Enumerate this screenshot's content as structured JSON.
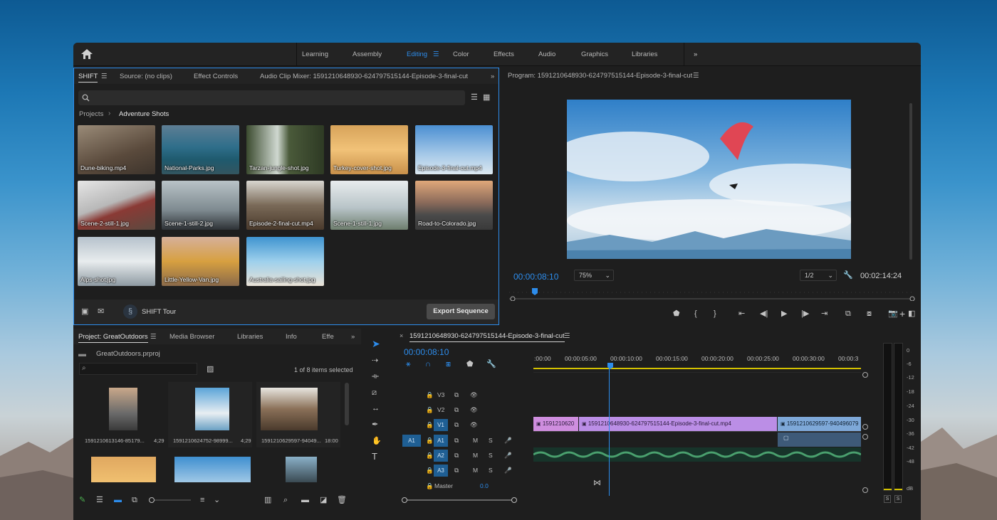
{
  "workspaces": [
    "Learning",
    "Assembly",
    "Editing",
    "Color",
    "Effects",
    "Audio",
    "Graphics",
    "Libraries"
  ],
  "active_workspace": "Editing",
  "source_tabs": {
    "shift": "SHIFT",
    "source": "Source: (no clips)",
    "effect_controls": "Effect Controls",
    "audio_mixer": "Audio Clip Mixer: 1591210648930-624797515144-Episode-3-final-cut"
  },
  "breadcrumb": {
    "root": "Projects",
    "current": "Adventure Shots"
  },
  "assets": [
    "Dune-biking.mp4",
    "National-Parks.jpg",
    "Tarzan-jungle-shot.jpg",
    "Turkey-cover-shot.jpg",
    "Episode-3-final-cut.mp4",
    "Scene-2-still-1.jpg",
    "Scene-1-still-2.jpg",
    "Episode-2-final-cut.mp4",
    "Scene-1-still-1.jpg",
    "Road-to-Colorado.jpg",
    "Alps-shot.jpg",
    "Little-Yellow-Van.jpg",
    "Australia-sailing-shot.jpg"
  ],
  "shift_tour": "SHIFT Tour",
  "export_button": "Export Sequence",
  "program": {
    "title": "Program: 1591210648930-624797515144-Episode-3-final-cut",
    "timecode": "00:00:08:10",
    "zoom": "75%",
    "resolution": "1/2",
    "duration": "00:02:14:24"
  },
  "project": {
    "tabs": [
      "Project: GreatOutdoors",
      "Media Browser",
      "Libraries",
      "Info",
      "Effe"
    ],
    "file": "GreatOutdoors.prproj",
    "count": "1 of 8 items selected",
    "items": [
      {
        "name": "1591210613146-85179...",
        "dur": "4;29"
      },
      {
        "name": "1591210624752-98999...",
        "dur": "4;29"
      },
      {
        "name": "1591210629597-94049...",
        "dur": "18:00"
      }
    ]
  },
  "timeline": {
    "title": "1591210648930-624797515144-Episode-3-final-cut",
    "timecode": "00:00:08:10",
    "ruler": [
      ":00:00",
      "00:00:05:00",
      "00:00:10:00",
      "00:00:15:00",
      "00:00:20:00",
      "00:00:25:00",
      "00:00:30:00",
      "00:00:3"
    ],
    "video_tracks": [
      "V3",
      "V2",
      "V1"
    ],
    "audio_tracks": [
      "A1",
      "A2",
      "A3"
    ],
    "source_patch": "A1",
    "master": "Master",
    "master_val": "0.0",
    "clips": [
      "1591210620",
      "1591210648930-624797515144-Episode-3-final-cut.mp4",
      "1591210629597-940496079"
    ]
  },
  "meter_scale": [
    "0",
    "-6",
    "-12",
    "-18",
    "-24",
    "-30",
    "-36",
    "-42",
    "-48",
    "dB"
  ],
  "meter_solo": [
    "S",
    "S"
  ]
}
